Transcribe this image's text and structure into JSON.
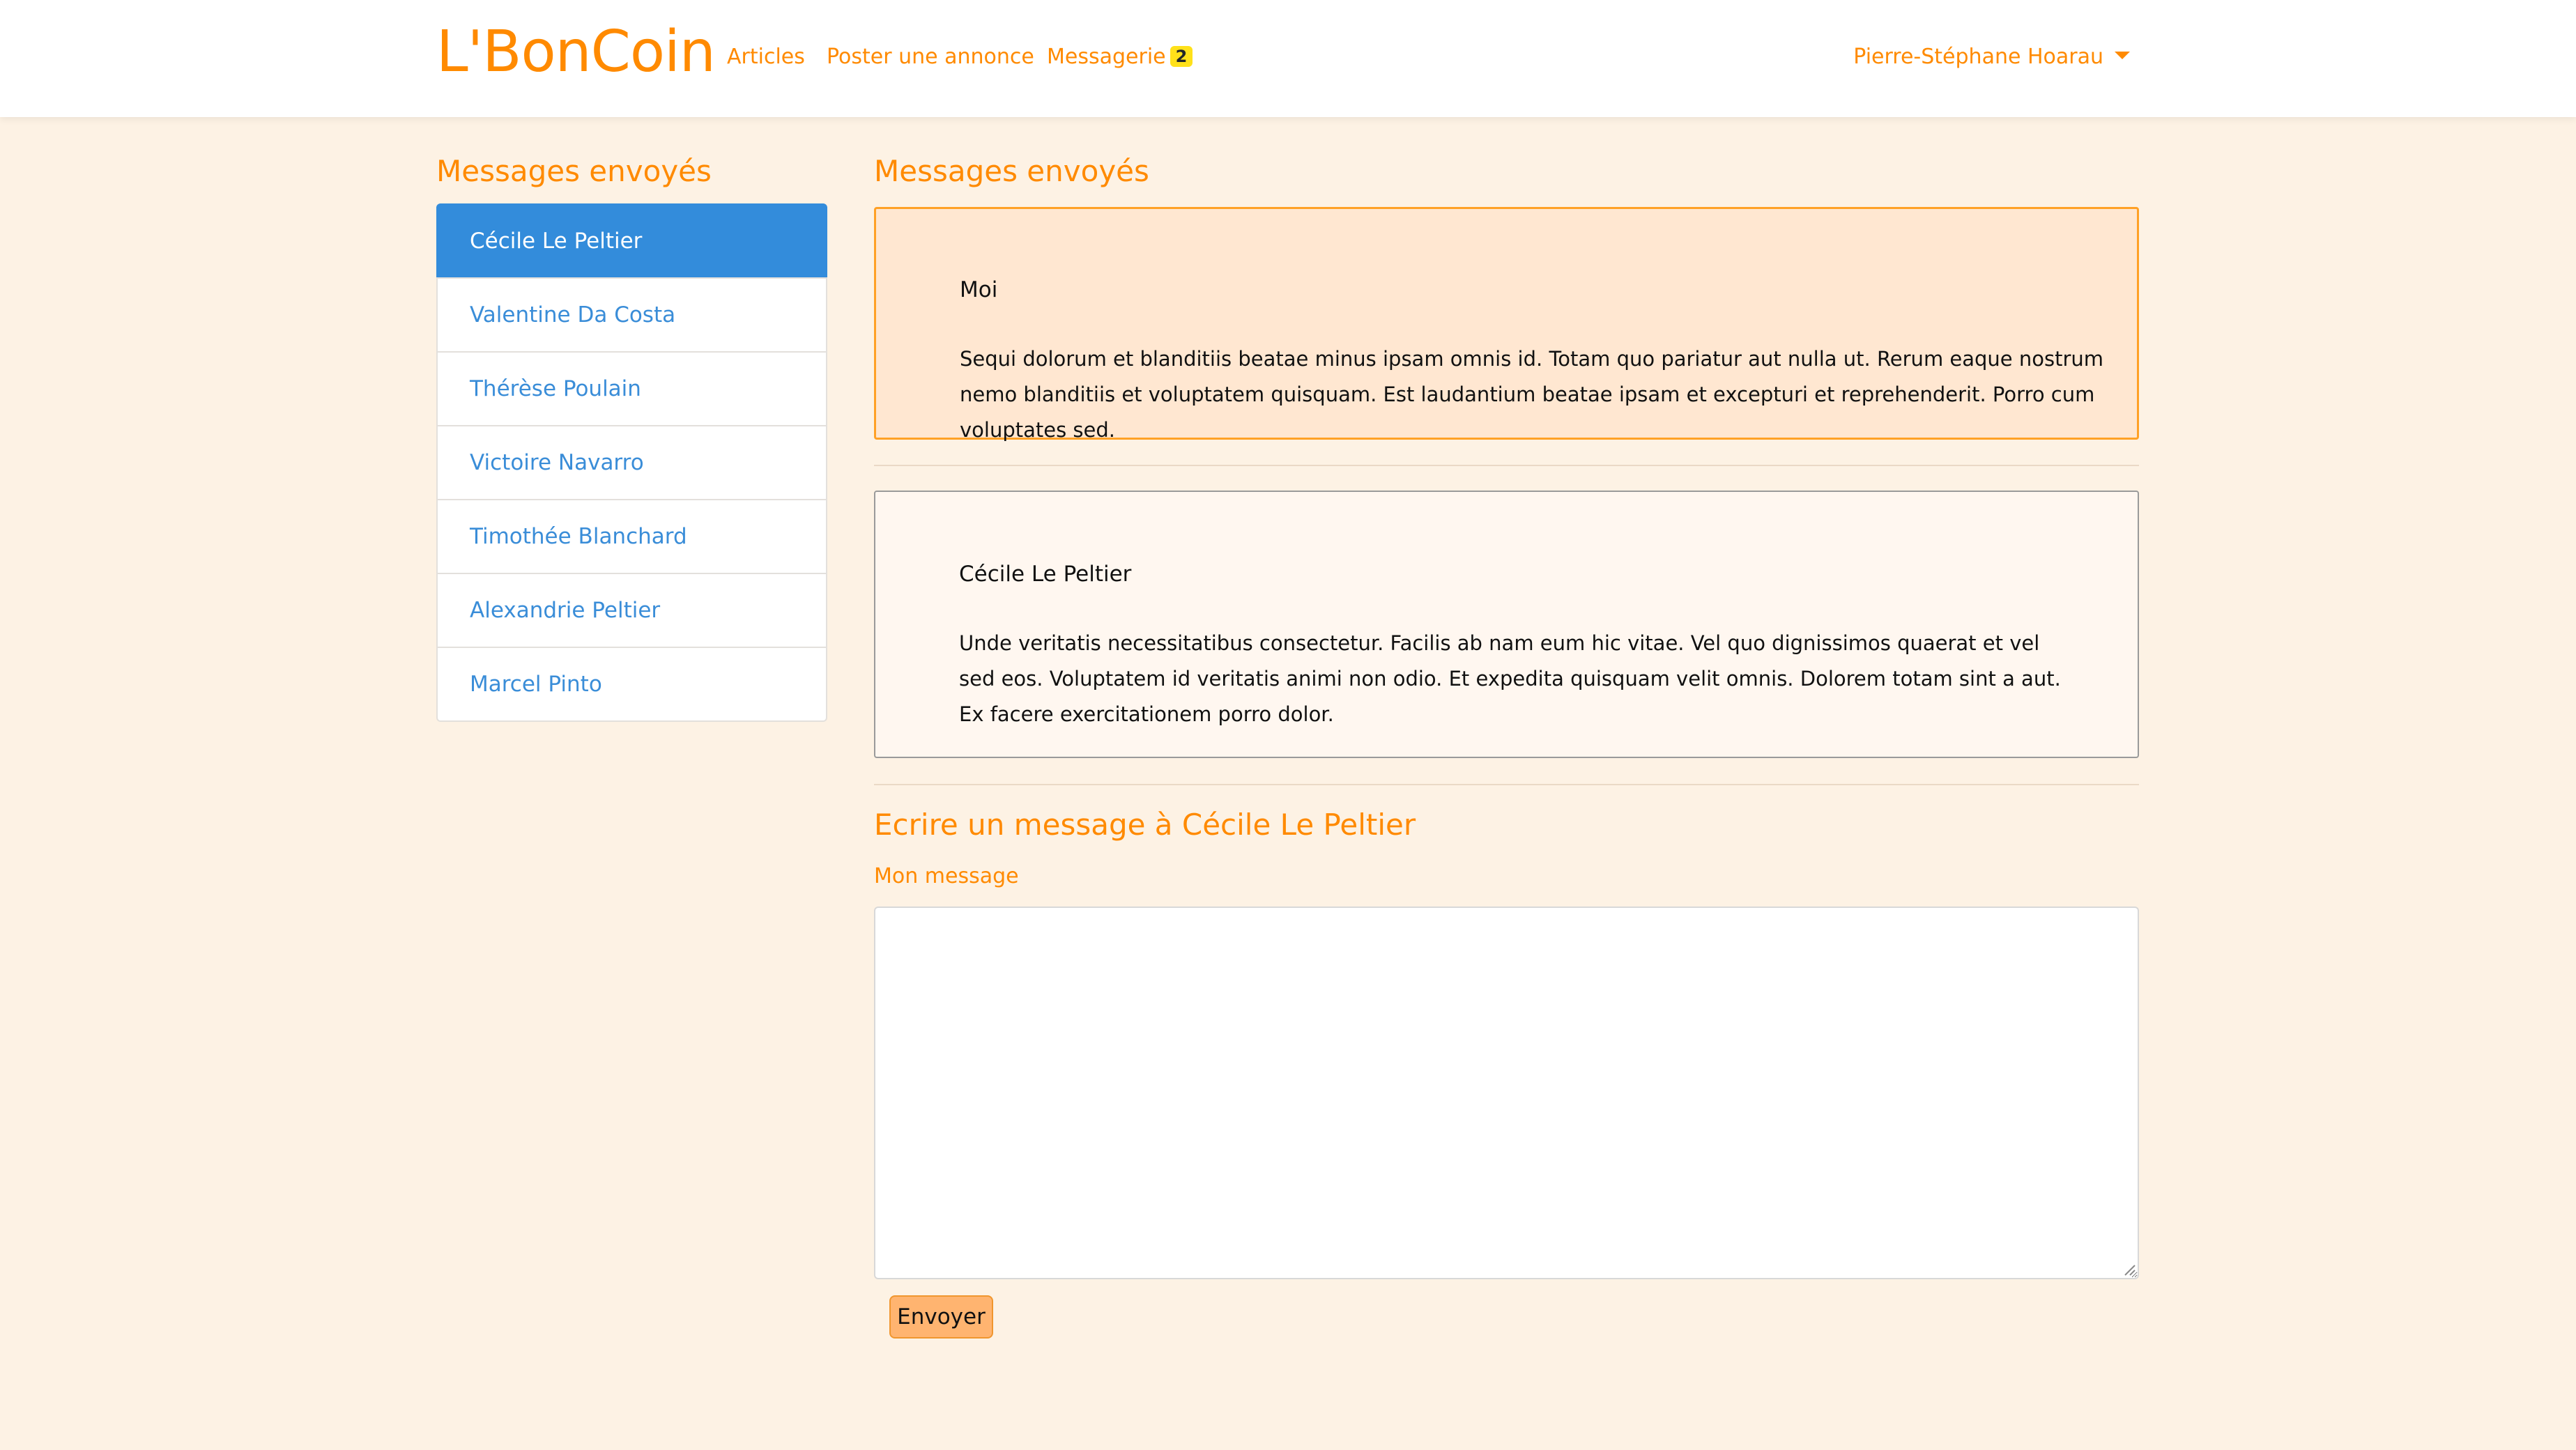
{
  "navbar": {
    "brand": "L'BonCoin",
    "links": {
      "articles": "Articles",
      "poster": "Poster une annonce",
      "messagerie": "Messagerie",
      "messagerie_badge": "2"
    },
    "user_name": "Pierre-Stéphane Hoarau"
  },
  "sidebar": {
    "title": "Messages envoyés",
    "items": [
      {
        "label": "Cécile Le Peltier"
      },
      {
        "label": "Valentine Da Costa"
      },
      {
        "label": "Thérèse Poulain"
      },
      {
        "label": "Victoire Navarro"
      },
      {
        "label": "Timothée Blanchard"
      },
      {
        "label": "Alexandrie Peltier"
      },
      {
        "label": "Marcel Pinto"
      }
    ]
  },
  "main": {
    "title": "Messages envoyés",
    "messages": [
      {
        "author": "Moi",
        "body": "Sequi dolorum et blanditiis beatae minus ipsam omnis id. Totam quo pariatur aut nulla ut. Rerum eaque nostrum nemo blanditiis et voluptatem quisquam. Est laudantium beatae ipsam et excepturi et reprehenderit. Porro cum voluptates sed."
      },
      {
        "author": "Cécile Le Peltier",
        "body": "Unde veritatis necessitatibus consectetur. Facilis ab nam eum hic vitae. Vel quo dignissimos quaerat et vel sed eos. Voluptatem id veritatis animi non odio. Et expedita quisquam velit omnis. Dolorem totam sint a aut. Ex facere exercitationem porro dolor."
      }
    ]
  },
  "form": {
    "title": "Ecrire un message à Cécile Le Peltier",
    "label": "Mon message",
    "value": "",
    "submit_label": "Envoyer"
  },
  "colors": {
    "accent": "#ff8a00",
    "active_item": "#338cdb",
    "link": "#3a8dd8",
    "badge": "#ffe11a",
    "page_background": "#fdf2e4",
    "my_message_background": "#ffe7d1",
    "my_message_border": "#ffa126",
    "send_button": "#ffb470"
  },
  "icons": {
    "user_menu": "caret-down-icon",
    "textarea_resize": "resize-grip-icon"
  }
}
